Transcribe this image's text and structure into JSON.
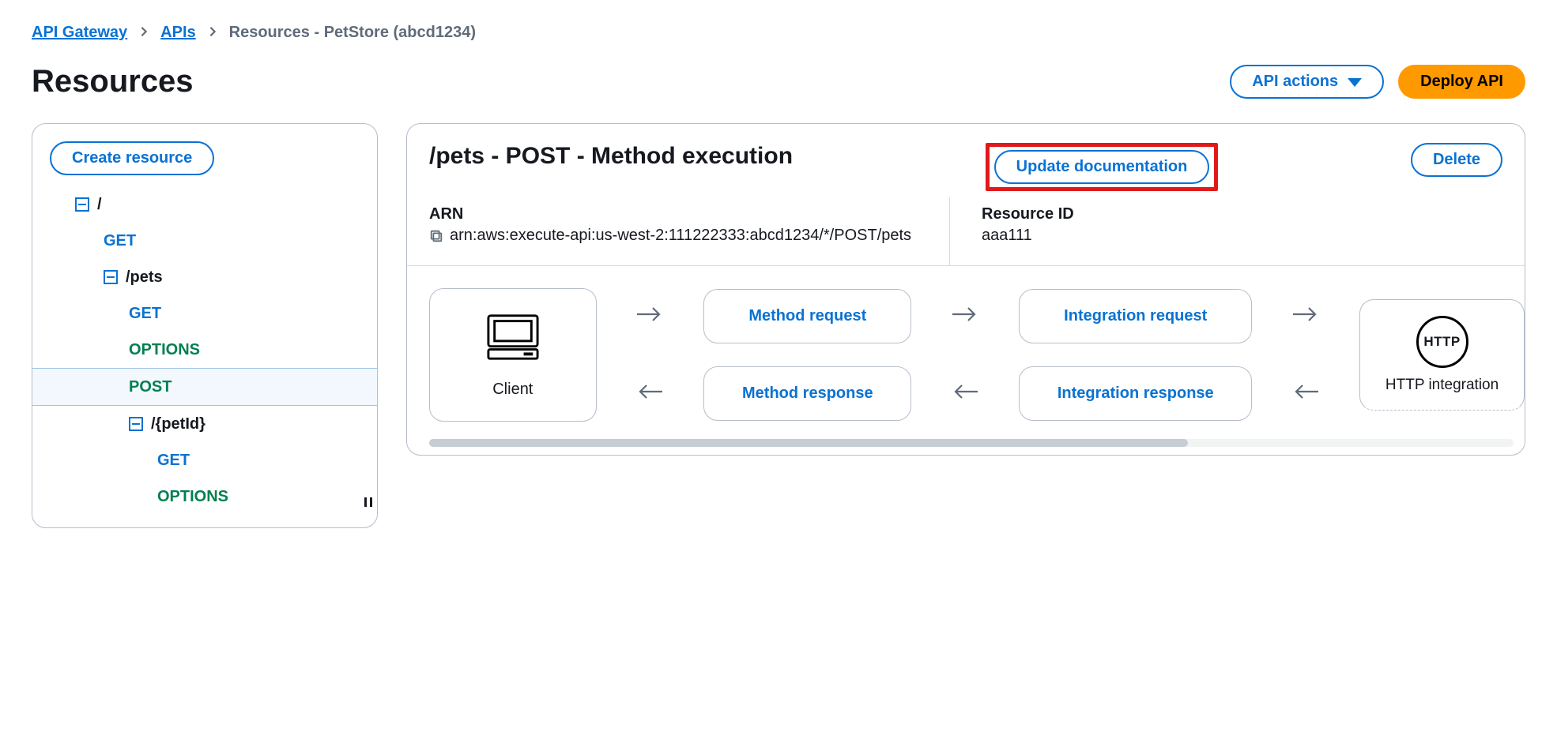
{
  "breadcrumb": {
    "root": "API Gateway",
    "apis": "APIs",
    "current": "Resources - PetStore (abcd1234)"
  },
  "page": {
    "title": "Resources"
  },
  "header_actions": {
    "api_actions": "API actions",
    "deploy": "Deploy API"
  },
  "left": {
    "create": "Create resource",
    "tree": {
      "root": "/",
      "root_get": "GET",
      "pets": "/pets",
      "pets_get": "GET",
      "pets_options": "OPTIONS",
      "pets_post": "POST",
      "petid": "/{petId}",
      "petid_get": "GET",
      "petid_options": "OPTIONS"
    }
  },
  "method": {
    "title": "/pets - POST - Method execution",
    "update_doc": "Update documentation",
    "delete": "Delete",
    "arn_label": "ARN",
    "arn_value": "arn:aws:execute-api:us-west-2:111222333:abcd1234/*/POST/pets",
    "resource_id_label": "Resource ID",
    "resource_id_value": "aaa111"
  },
  "flow": {
    "client": "Client",
    "method_request": "Method request",
    "integration_request": "Integration request",
    "method_response": "Method response",
    "integration_response": "Integration response",
    "http_badge": "HTTP",
    "endpoint_label": "HTTP integration"
  }
}
